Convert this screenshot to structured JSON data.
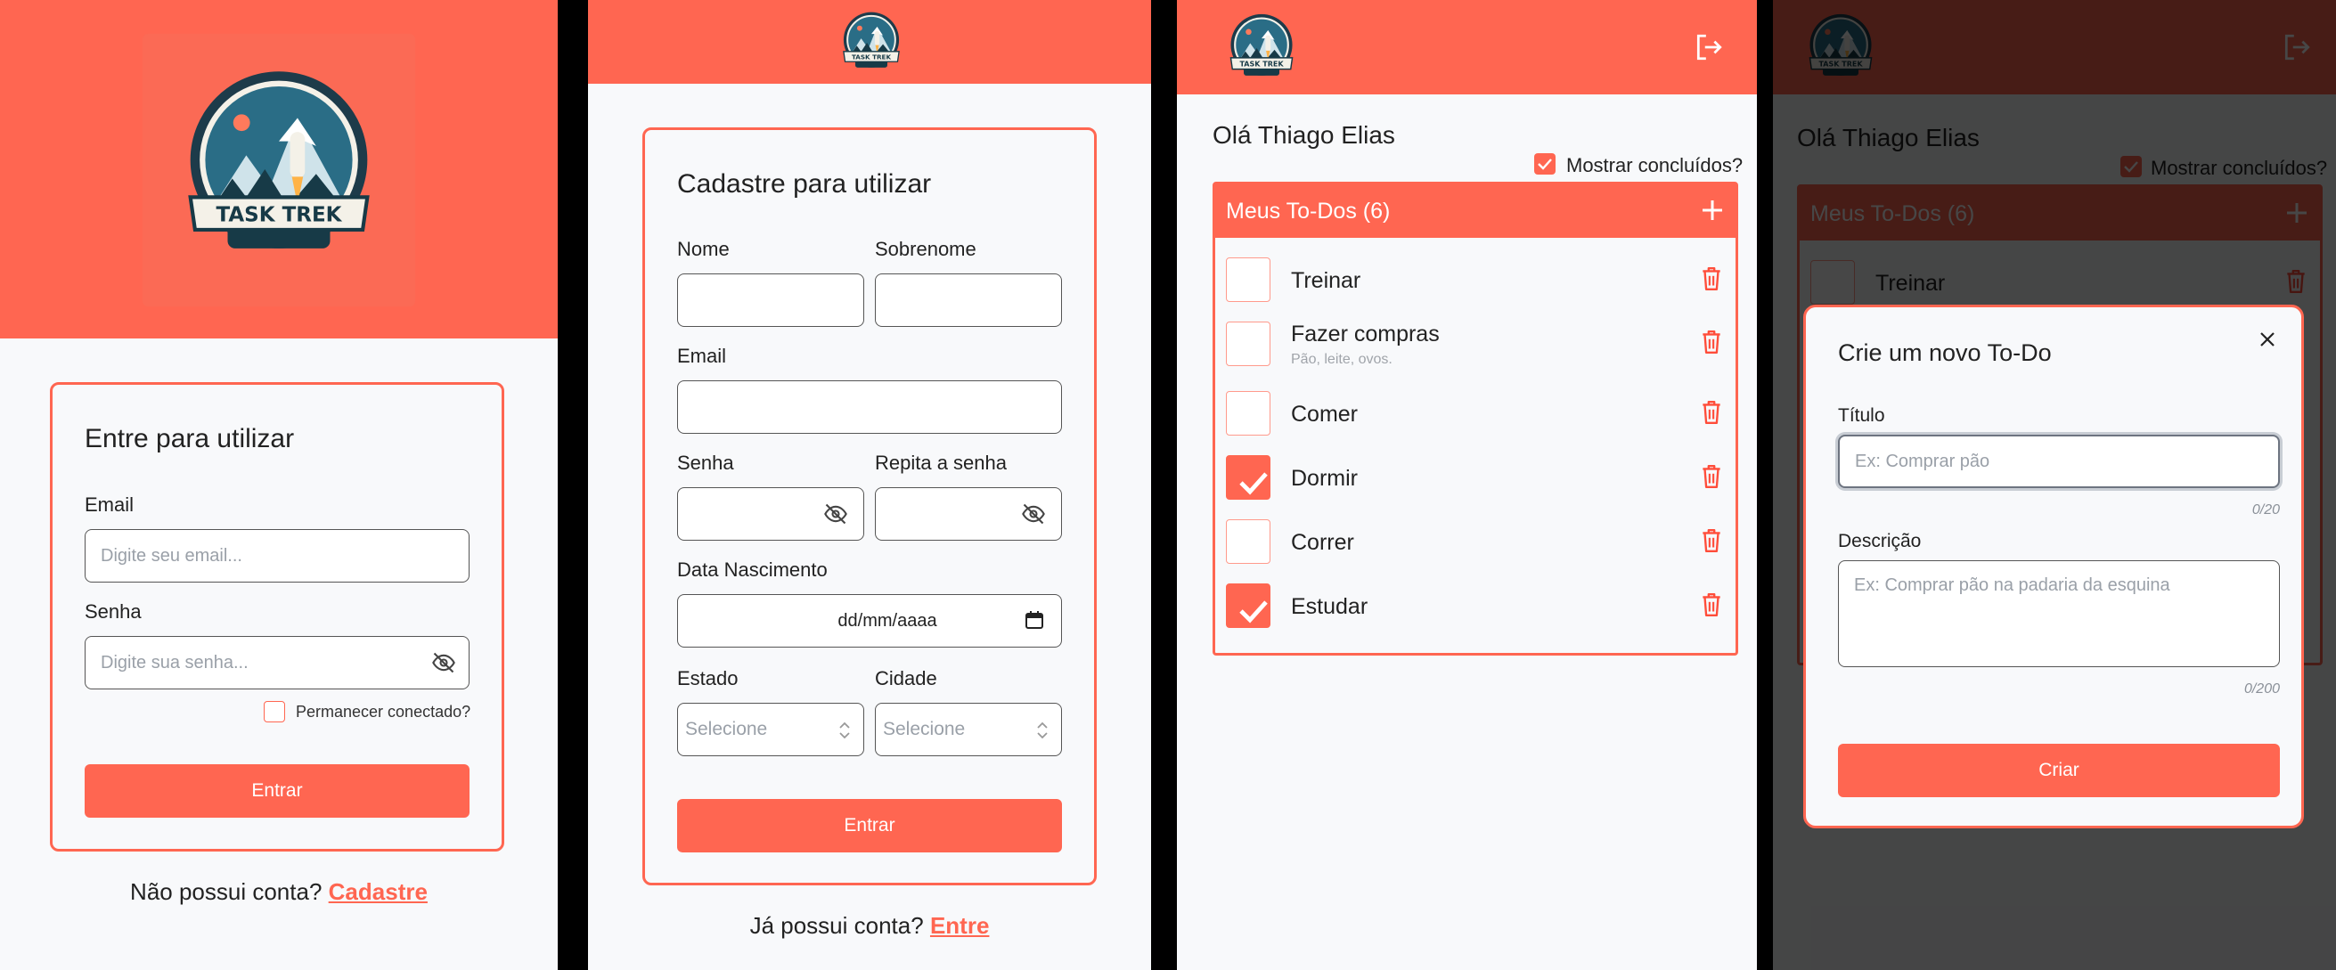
{
  "colors": {
    "accent": "#ff6651",
    "background": "#f8f9fb",
    "overlay": "rgba(0,0,0,0.72)"
  },
  "brand": {
    "logo_text": "TASK TREK"
  },
  "login": {
    "title": "Entre para utilizar",
    "email_label": "Email",
    "email_placeholder": "Digite seu email...",
    "password_label": "Senha",
    "password_placeholder": "Digite sua senha...",
    "remember_label": "Permanecer conectado?",
    "submit_label": "Entrar",
    "footer_text": "Não possui conta?",
    "footer_link": "Cadastre"
  },
  "register": {
    "title": "Cadastre para utilizar",
    "first_name_label": "Nome",
    "last_name_label": "Sobrenome",
    "email_label": "Email",
    "password_label": "Senha",
    "repeat_password_label": "Repita a senha",
    "birth_label": "Data Nascimento",
    "birth_placeholder": "dd/mm/aaaa",
    "state_label": "Estado",
    "state_value": "Selecione",
    "city_label": "Cidade",
    "city_value": "Selecione",
    "submit_label": "Entrar",
    "footer_text": "Já possui conta?",
    "footer_link": "Entre"
  },
  "todos": {
    "greeting": "Olá Thiago Elias",
    "show_done_label": "Mostrar concluídos?",
    "show_done_checked": true,
    "list_title": "Meus To-Dos (6)",
    "items": [
      {
        "title": "Treinar",
        "description": "",
        "done": false
      },
      {
        "title": "Fazer compras",
        "description": "Pão, leite, ovos.",
        "done": false
      },
      {
        "title": "Comer",
        "description": "",
        "done": false
      },
      {
        "title": "Dormir",
        "description": "",
        "done": true
      },
      {
        "title": "Correr",
        "description": "",
        "done": false
      },
      {
        "title": "Estudar",
        "description": "",
        "done": true
      }
    ]
  },
  "modal": {
    "title": "Crie um novo To-Do",
    "title_label": "Título",
    "title_placeholder": "Ex: Comprar pão",
    "title_counter": "0/20",
    "desc_label": "Descrição",
    "desc_placeholder": "Ex: Comprar pão na padaria da esquina",
    "desc_counter": "0/200",
    "submit_label": "Criar"
  },
  "icons": {
    "logo": "task-trek-logo",
    "eye": "eye-off-icon",
    "logout": "logout-icon",
    "add": "plus-icon",
    "delete": "trash-icon",
    "close": "close-icon",
    "calendar": "calendar-icon",
    "check": "check-icon"
  }
}
